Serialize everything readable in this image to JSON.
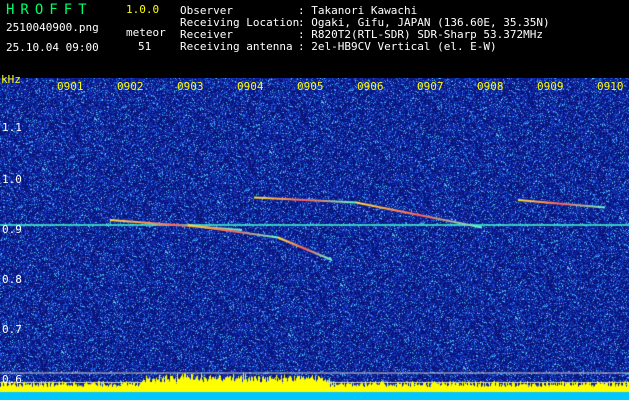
{
  "app": {
    "title": "HROFFT",
    "version": "1.0.0",
    "file_name": "2510040900.png",
    "datetime": "25.10.04 09:00",
    "meteor_label": "meteor",
    "meteor_count": "51"
  },
  "info": {
    "rows": [
      {
        "key": "Observer",
        "value": ": Takanori Kawachi"
      },
      {
        "key": "Receiving Location",
        "value": ": Ogaki, Gifu, JAPAN (136.60E, 35.35N)"
      },
      {
        "key": "Receiver",
        "value": ": R820T2(RTL-SDR) SDR-Sharp 53.372MHz"
      },
      {
        "key": "Receiving antenna",
        "value": ": 2el-HB9CV Vertical (el. E-W)"
      }
    ]
  },
  "axes": {
    "y_unit": "kHz",
    "y_ticks": [
      "1.1",
      "1.0",
      "0.9",
      "0.8",
      "0.7",
      "0.6"
    ],
    "x_ticks": [
      "0901",
      "0902",
      "0903",
      "0904",
      "0905",
      "0906",
      "0907",
      "0908",
      "0909",
      "0910"
    ]
  },
  "colors": {
    "background": "#000000",
    "noise_base": "#0c1a8a",
    "carrier": "#40ffd0",
    "header_green": "#00ff66",
    "tick_yellow": "#ffff00",
    "signal_bar": "#ffff00",
    "baseline": "#00c8ff"
  },
  "chart_data": {
    "type": "heatmap",
    "y_axis": {
      "label": "kHz",
      "range": [
        0.58,
        1.2
      ],
      "ticks": [
        1.1,
        1.0,
        0.9,
        0.8,
        0.7,
        0.6
      ]
    },
    "x_axis": {
      "ticks": [
        "0901",
        "0902",
        "0903",
        "0904",
        "0905",
        "0906",
        "0907",
        "0908",
        "0909",
        "0910"
      ],
      "range_minutes": [
        0,
        10
      ]
    },
    "carrier_khz": 0.91,
    "meteor_echoes": [
      {
        "start_min": 1.7,
        "end_min": 3.9,
        "start_khz": 0.92,
        "end_khz": 0.9
      },
      {
        "start_min": 3.0,
        "end_min": 4.5,
        "start_khz": 0.91,
        "end_khz": 0.885
      },
      {
        "start_min": 4.5,
        "end_min": 5.4,
        "start_khz": 0.885,
        "end_khz": 0.84
      },
      {
        "start_min": 4.1,
        "end_min": 5.8,
        "start_khz": 0.965,
        "end_khz": 0.955
      },
      {
        "start_min": 5.8,
        "end_min": 7.9,
        "start_khz": 0.955,
        "end_khz": 0.905
      },
      {
        "start_min": 8.5,
        "end_min": 9.95,
        "start_khz": 0.96,
        "end_khz": 0.945
      }
    ]
  }
}
